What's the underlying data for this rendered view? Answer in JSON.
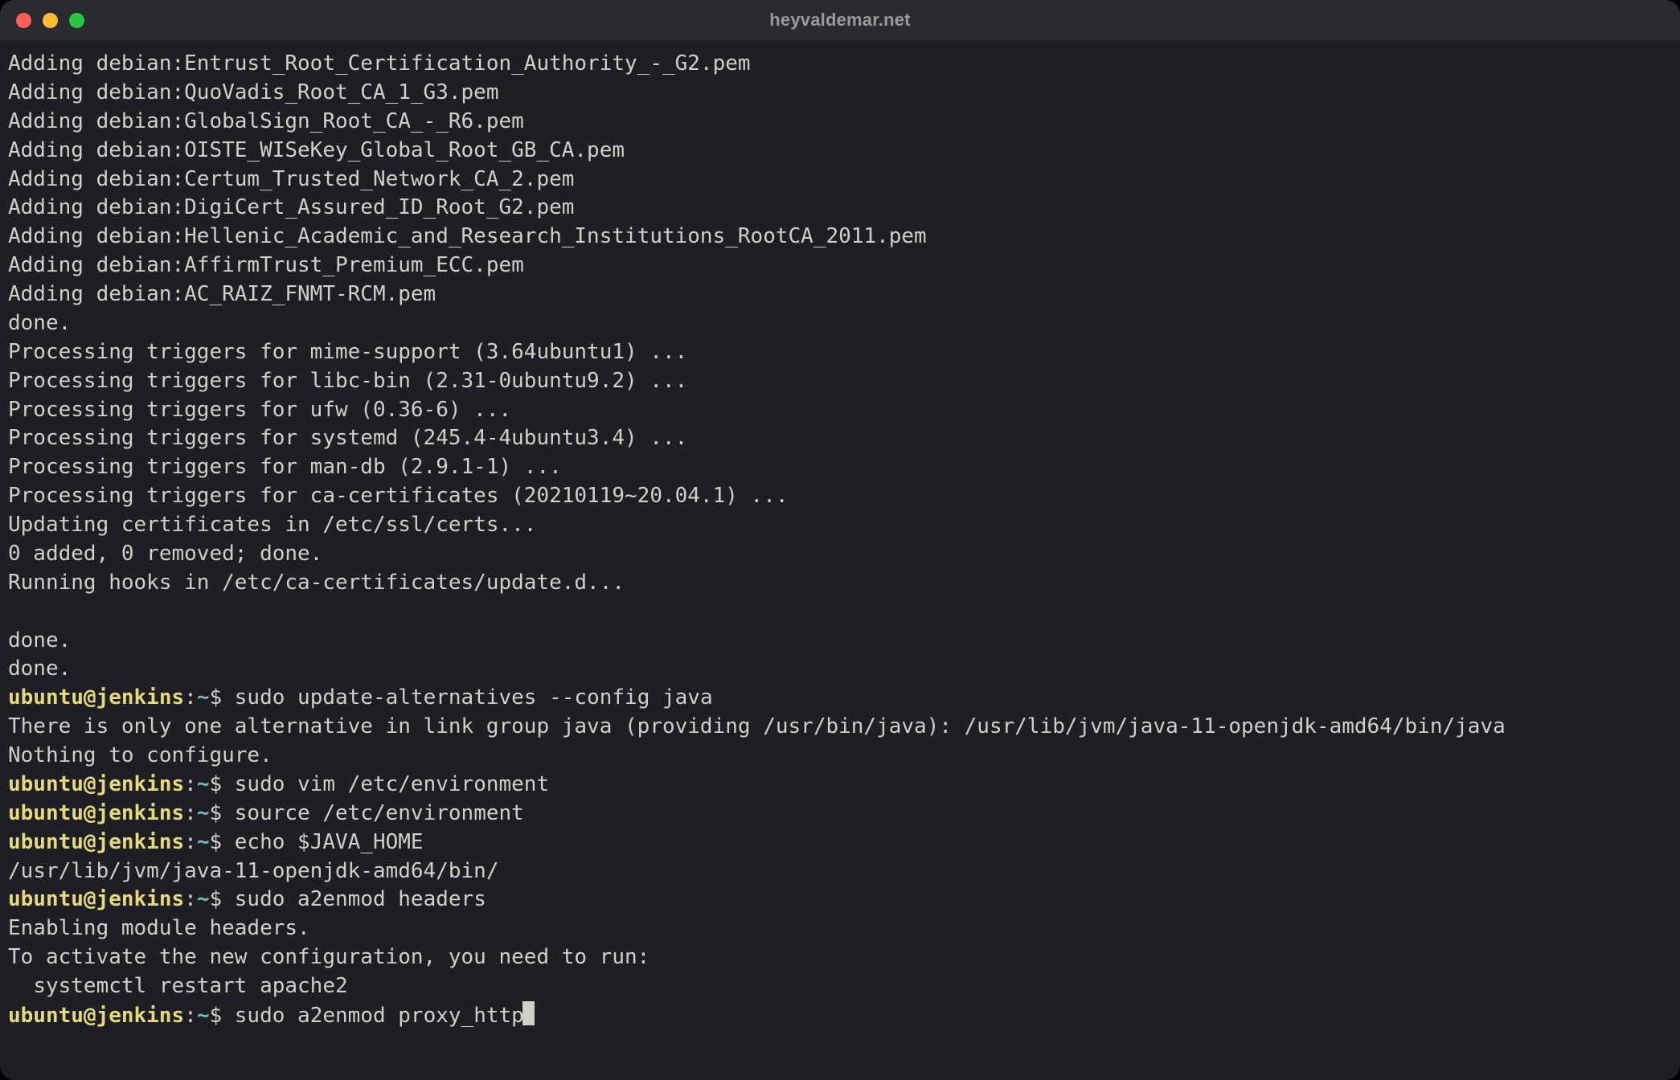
{
  "window": {
    "title": "heyvaldemar.net"
  },
  "prompt": {
    "user_host": "ubuntu@jenkins",
    "colon": ":",
    "path": "~",
    "symbol": "$"
  },
  "output": {
    "lines": [
      "Adding debian:Entrust_Root_Certification_Authority_-_G2.pem",
      "Adding debian:QuoVadis_Root_CA_1_G3.pem",
      "Adding debian:GlobalSign_Root_CA_-_R6.pem",
      "Adding debian:OISTE_WISeKey_Global_Root_GB_CA.pem",
      "Adding debian:Certum_Trusted_Network_CA_2.pem",
      "Adding debian:DigiCert_Assured_ID_Root_G2.pem",
      "Adding debian:Hellenic_Academic_and_Research_Institutions_RootCA_2011.pem",
      "Adding debian:AffirmTrust_Premium_ECC.pem",
      "Adding debian:AC_RAIZ_FNMT-RCM.pem",
      "done.",
      "Processing triggers for mime-support (3.64ubuntu1) ...",
      "Processing triggers for libc-bin (2.31-0ubuntu9.2) ...",
      "Processing triggers for ufw (0.36-6) ...",
      "Processing triggers for systemd (245.4-4ubuntu3.4) ...",
      "Processing triggers for man-db (2.9.1-1) ...",
      "Processing triggers for ca-certificates (20210119~20.04.1) ...",
      "Updating certificates in /etc/ssl/certs...",
      "0 added, 0 removed; done.",
      "Running hooks in /etc/ca-certificates/update.d...",
      "",
      "done.",
      "done."
    ]
  },
  "history": [
    {
      "command": "sudo update-alternatives --config java",
      "output": [
        "There is only one alternative in link group java (providing /usr/bin/java): /usr/lib/jvm/java-11-openjdk-amd64/bin/java",
        "Nothing to configure."
      ]
    },
    {
      "command": "sudo vim /etc/environment",
      "output": []
    },
    {
      "command": "source /etc/environment",
      "output": []
    },
    {
      "command": "echo $JAVA_HOME",
      "output": [
        "/usr/lib/jvm/java-11-openjdk-amd64/bin/"
      ]
    },
    {
      "command": "sudo a2enmod headers",
      "output": [
        "Enabling module headers.",
        "To activate the new configuration, you need to run:",
        "  systemctl restart apache2"
      ]
    }
  ],
  "current": {
    "command": "sudo a2enmod proxy_http"
  }
}
